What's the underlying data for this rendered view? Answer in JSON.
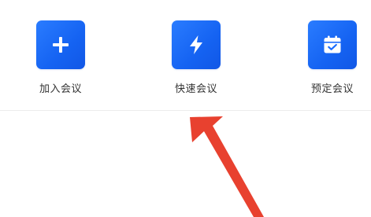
{
  "actions": [
    {
      "id": "join",
      "label": "加入会议",
      "icon": "plus-icon"
    },
    {
      "id": "quick",
      "label": "快速会议",
      "icon": "lightning-bolt-icon"
    },
    {
      "id": "schedule",
      "label": "预定会议",
      "icon": "calendar-check-icon"
    }
  ],
  "colors": {
    "tile_blue": "#1a6cff",
    "annotation_arrow": "#e8412f"
  }
}
